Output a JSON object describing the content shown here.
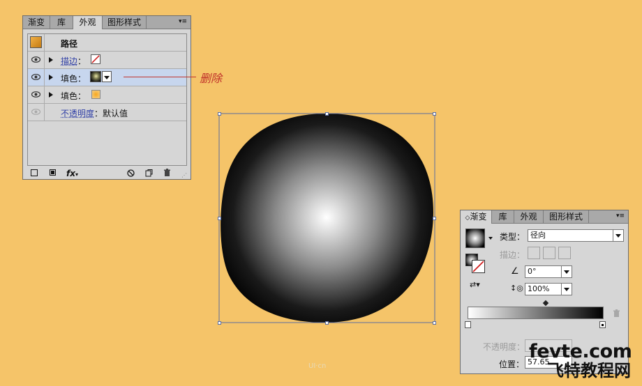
{
  "appearance_panel": {
    "tabs": [
      {
        "label": "渐变",
        "active": false
      },
      {
        "label": "库",
        "active": false
      },
      {
        "label": "外观",
        "active": true
      },
      {
        "label": "图形样式",
        "active": false
      }
    ],
    "header_label": "路径",
    "rows": [
      {
        "label": "描边",
        "colon": "：",
        "swatch": "stroke-none",
        "selected": false
      },
      {
        "label": "填色",
        "colon": "：",
        "swatch": "radial-dark",
        "selected": true
      },
      {
        "label": "填色",
        "colon": "：",
        "swatch": "orange",
        "selected": false
      }
    ],
    "opacity_label": "不透明度",
    "opacity_colon": "：",
    "opacity_value": "默认值",
    "bottom_icons": [
      "new-stroke-icon",
      "new-fill-icon",
      "fx-icon",
      "clear-icon",
      "duplicate-icon",
      "delete-icon"
    ],
    "fx_label": "fx"
  },
  "annotation": {
    "text": "删除"
  },
  "gradient_panel": {
    "tabs": [
      {
        "label": "渐变",
        "active": true
      },
      {
        "label": "库",
        "active": false
      },
      {
        "label": "外观",
        "active": false
      },
      {
        "label": "图形样式",
        "active": false
      }
    ],
    "type_label": "类型：",
    "type_value": "径向",
    "stroke_label": "描边：",
    "angle_value": "0°",
    "aspect_value": "100%",
    "opacity_label": "不透明度：",
    "position_label": "位置：",
    "position_value": "57.65"
  },
  "colors": {
    "background": "#f5c469",
    "annotation": "#c0302a",
    "selection": "#5a6da0",
    "link": "#2f3fa6"
  },
  "watermark": {
    "main": "fevte.com",
    "sub": "飞特教程网",
    "small": "UI·cn"
  }
}
